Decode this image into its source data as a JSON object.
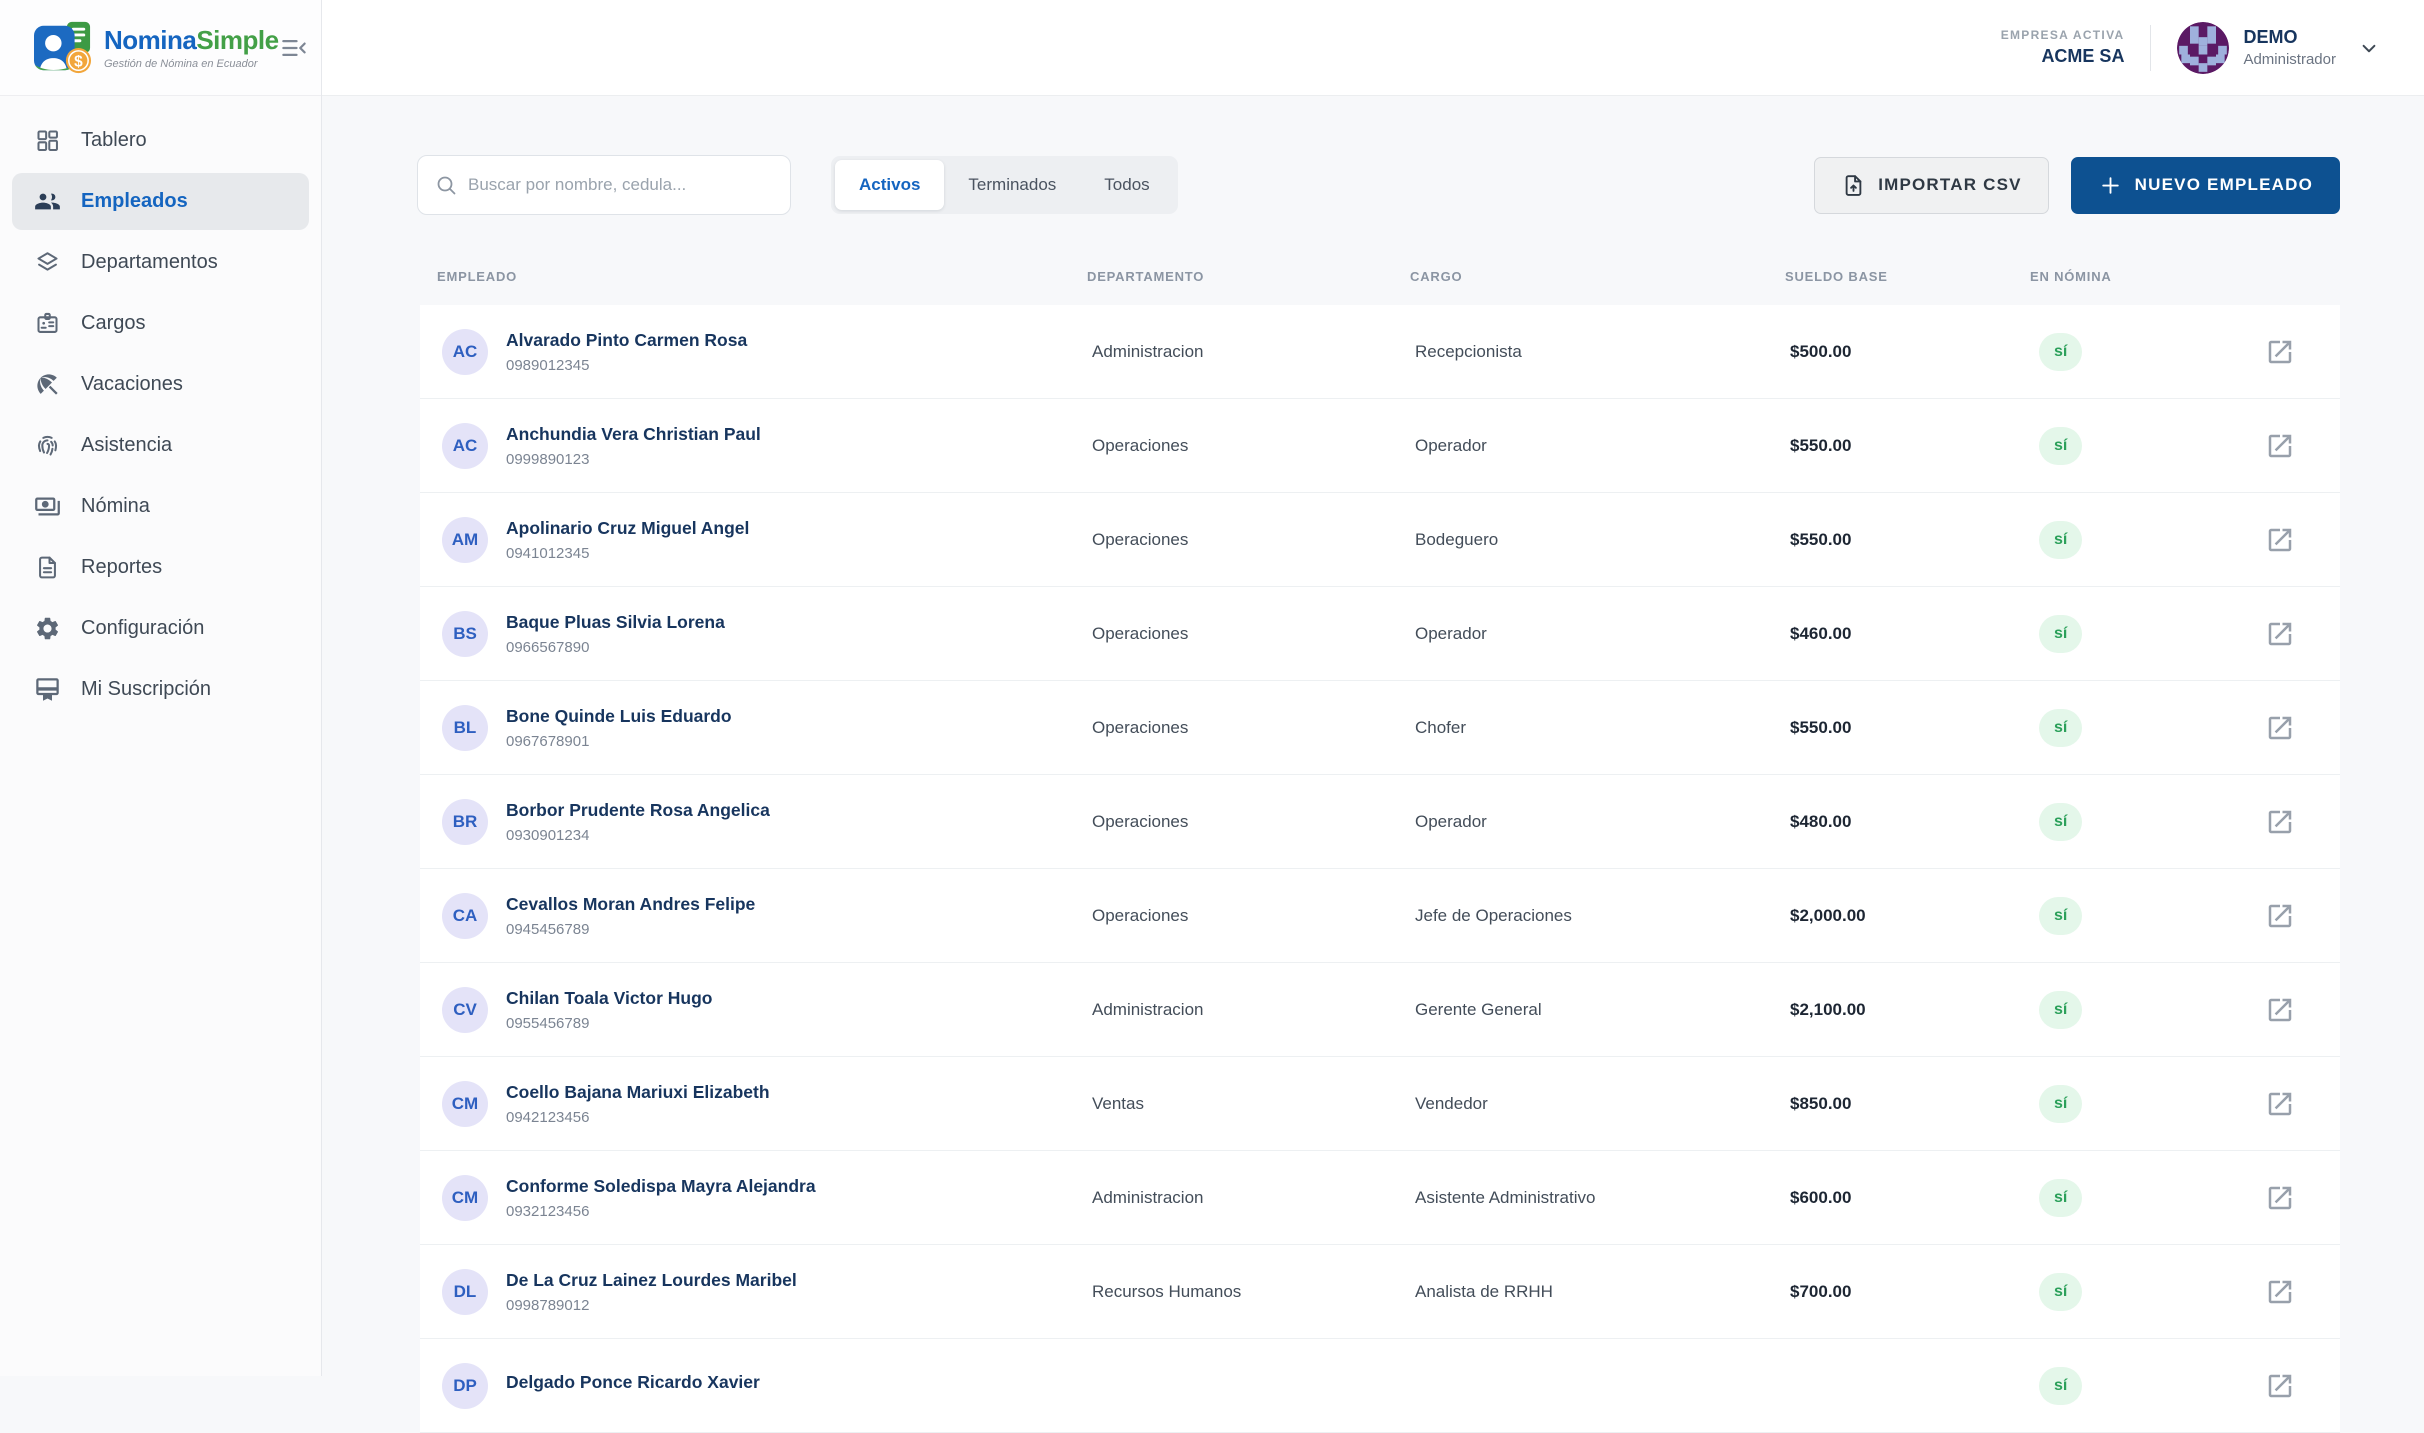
{
  "brand": {
    "name_blue": "Nomina",
    "name_green": "Simple",
    "tagline": "Gestión de Nómina en Ecuador",
    "logo_icon": "nomina-logo-icon"
  },
  "header": {
    "company_label": "EMPRESA ACTIVA",
    "company_name": "ACME SA",
    "user_name": "DEMO",
    "user_role": "Administrador",
    "avatar_icon": "identicon-avatar",
    "chevron_icon": "chevron-down-icon",
    "menu_toggle_icon": "menu-open-icon"
  },
  "sidebar": {
    "items": [
      {
        "label": "Tablero",
        "icon": "dashboard-icon",
        "active": false
      },
      {
        "label": "Empleados",
        "icon": "employees-icon",
        "active": true
      },
      {
        "label": "Departamentos",
        "icon": "departments-icon",
        "active": false
      },
      {
        "label": "Cargos",
        "icon": "positions-icon",
        "active": false
      },
      {
        "label": "Vacaciones",
        "icon": "vacations-icon",
        "active": false
      },
      {
        "label": "Asistencia",
        "icon": "attendance-icon",
        "active": false
      },
      {
        "label": "Nómina",
        "icon": "payroll-icon",
        "active": false
      },
      {
        "label": "Reportes",
        "icon": "reports-icon",
        "active": false
      },
      {
        "label": "Configuración",
        "icon": "settings-icon",
        "active": false
      },
      {
        "label": "Mi Suscripción",
        "icon": "subscription-icon",
        "active": false
      }
    ]
  },
  "toolbar": {
    "search_placeholder": "Buscar por nombre, cedula...",
    "search_icon": "search-icon",
    "tabs": [
      {
        "label": "Activos",
        "active": true
      },
      {
        "label": "Terminados",
        "active": false
      },
      {
        "label": "Todos",
        "active": false
      }
    ],
    "import_button": "IMPORTAR CSV",
    "import_icon": "upload-file-icon",
    "new_button": "NUEVO EMPLEADO",
    "new_icon": "plus-icon"
  },
  "table": {
    "columns": [
      "EMPLEADO",
      "DEPARTAMENTO",
      "CARGO",
      "SUELDO BASE",
      "EN NÓMINA"
    ],
    "row_action_icon": "open-in-new-icon",
    "rows": [
      {
        "initials": "AC",
        "name": "Alvarado Pinto Carmen Rosa",
        "cedula": "0989012345",
        "department": "Administracion",
        "position": "Recepcionista",
        "salary": "$500.00",
        "en_nomina": "sí"
      },
      {
        "initials": "AC",
        "name": "Anchundia Vera Christian Paul",
        "cedula": "0999890123",
        "department": "Operaciones",
        "position": "Operador",
        "salary": "$550.00",
        "en_nomina": "sí"
      },
      {
        "initials": "AM",
        "name": "Apolinario Cruz Miguel Angel",
        "cedula": "0941012345",
        "department": "Operaciones",
        "position": "Bodeguero",
        "salary": "$550.00",
        "en_nomina": "sí"
      },
      {
        "initials": "BS",
        "name": "Baque Pluas Silvia Lorena",
        "cedula": "0966567890",
        "department": "Operaciones",
        "position": "Operador",
        "salary": "$460.00",
        "en_nomina": "sí"
      },
      {
        "initials": "BL",
        "name": "Bone Quinde Luis Eduardo",
        "cedula": "0967678901",
        "department": "Operaciones",
        "position": "Chofer",
        "salary": "$550.00",
        "en_nomina": "sí"
      },
      {
        "initials": "BR",
        "name": "Borbor Prudente Rosa Angelica",
        "cedula": "0930901234",
        "department": "Operaciones",
        "position": "Operador",
        "salary": "$480.00",
        "en_nomina": "sí"
      },
      {
        "initials": "CA",
        "name": "Cevallos Moran Andres Felipe",
        "cedula": "0945456789",
        "department": "Operaciones",
        "position": "Jefe de Operaciones",
        "salary": "$2,000.00",
        "en_nomina": "sí"
      },
      {
        "initials": "CV",
        "name": "Chilan Toala Victor Hugo",
        "cedula": "0955456789",
        "department": "Administracion",
        "position": "Gerente General",
        "salary": "$2,100.00",
        "en_nomina": "sí"
      },
      {
        "initials": "CM",
        "name": "Coello Bajana Mariuxi Elizabeth",
        "cedula": "0942123456",
        "department": "Ventas",
        "position": "Vendedor",
        "salary": "$850.00",
        "en_nomina": "sí"
      },
      {
        "initials": "CM",
        "name": "Conforme Soledispa Mayra Alejandra",
        "cedula": "0932123456",
        "department": "Administracion",
        "position": "Asistente Administrativo",
        "salary": "$600.00",
        "en_nomina": "sí"
      },
      {
        "initials": "DL",
        "name": "De La Cruz Lainez Lourdes Maribel",
        "cedula": "0998789012",
        "department": "Recursos Humanos",
        "position": "Analista de RRHH",
        "salary": "$700.00",
        "en_nomina": "sí"
      },
      {
        "initials": "DP",
        "name": "Delgado Ponce Ricardo Xavier",
        "cedula": "",
        "department": "",
        "position": "",
        "salary": "",
        "en_nomina": "sí"
      }
    ]
  },
  "colors": {
    "primary_button": "#0d5191",
    "brand_blue": "#1565c0",
    "brand_green": "#43a047",
    "active_tab_text": "#1565c0",
    "badge_bg": "#e4f7ea",
    "badge_text": "#2ba05a",
    "name_text": "#17355e",
    "avatar_bg": "#e4e3f8",
    "avatar_text": "#2e5fc0",
    "page_bg": "#f7f8fa"
  }
}
